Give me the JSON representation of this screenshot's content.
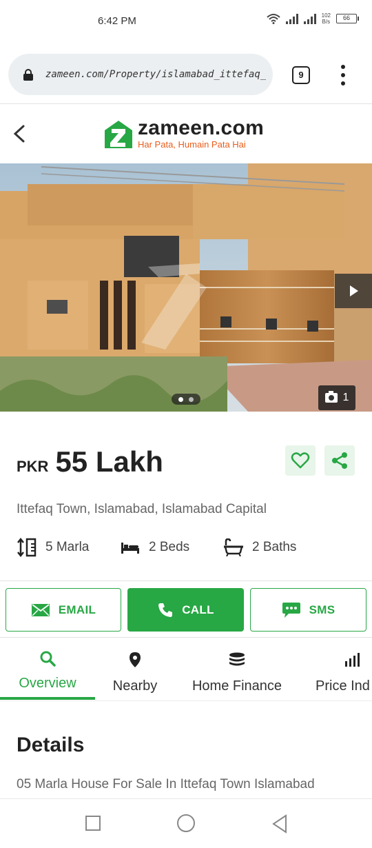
{
  "status_bar": {
    "time": "6:42 PM",
    "net_rate_top": "102",
    "net_rate_bottom": "B/s",
    "battery": "66"
  },
  "browser": {
    "url": "zameen.com/Property/islamabad_ittefaq_to",
    "tab_count": "9"
  },
  "site": {
    "name": "zameen.com",
    "tagline": "Har Pata, Humain Pata Hai"
  },
  "gallery": {
    "photo_count": "1"
  },
  "listing": {
    "currency": "PKR",
    "price": "55 Lakh",
    "location": "Ittefaq Town, Islamabad, Islamabad Capital",
    "area": "5 Marla",
    "beds": "2 Beds",
    "baths": "2 Baths"
  },
  "actions": {
    "email": "EMAIL",
    "call": "CALL",
    "sms": "SMS"
  },
  "tabs": [
    {
      "label": "Overview",
      "icon": "search-icon",
      "active": true
    },
    {
      "label": "Nearby",
      "icon": "location-pin-icon"
    },
    {
      "label": "Home Finance",
      "icon": "coins-icon"
    },
    {
      "label": "Price Ind",
      "icon": "bar-chart-icon"
    }
  ],
  "details": {
    "title": "Details",
    "description": "05 Marla House For Sale In Ittefaq Town Islamabad"
  },
  "colors": {
    "brand_green": "#28a745",
    "brand_orange": "#e85d1b"
  }
}
